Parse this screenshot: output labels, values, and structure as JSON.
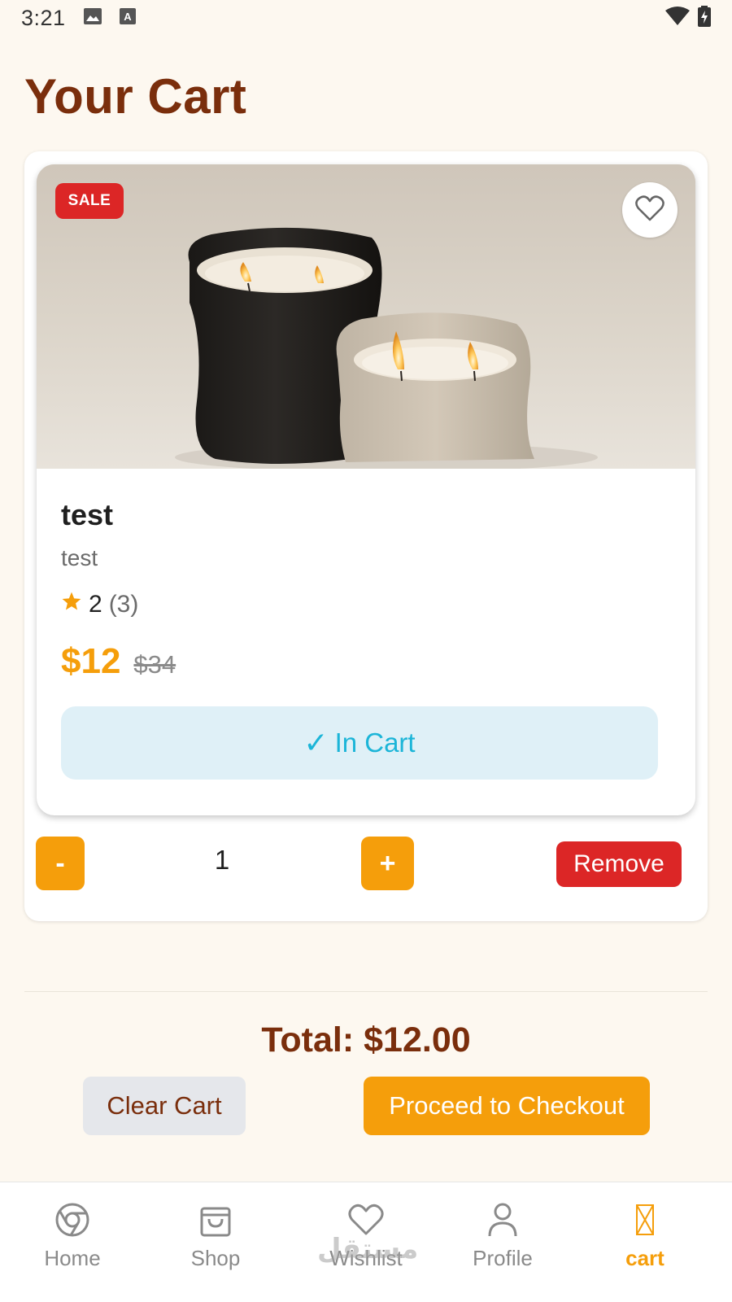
{
  "status_bar": {
    "time": "3:21",
    "icons": [
      "image-icon",
      "font-a-icon",
      "wifi-icon",
      "battery-charging-icon"
    ]
  },
  "page": {
    "title": "Your Cart"
  },
  "colors": {
    "title": "#7a2e0c",
    "accent": "#f59e0b",
    "danger": "#dc2626",
    "in_cart_bg": "#dff0f7",
    "in_cart_text": "#1cb5d8",
    "background": "#fdf8f0"
  },
  "cart_item": {
    "badge": "SALE",
    "name": "test",
    "description": "test",
    "rating": "2",
    "rating_count": "(3)",
    "price": "$12",
    "original_price": "$34",
    "in_cart_check": "✓",
    "in_cart_label": "In Cart",
    "quantity": "1",
    "minus_label": "-",
    "plus_label": "+",
    "remove_label": "Remove"
  },
  "summary": {
    "total": "Total: $12.00",
    "clear_label": "Clear Cart",
    "checkout_label": "Proceed to Checkout"
  },
  "nav": {
    "items": [
      {
        "label": "Home",
        "icon": "chrome-icon"
      },
      {
        "label": "Shop",
        "icon": "shopping-bag-icon"
      },
      {
        "label": "Wishlist",
        "icon": "heart-icon"
      },
      {
        "label": "Profile",
        "icon": "user-icon"
      },
      {
        "label": "cart",
        "icon": "cart-icon",
        "active": true
      }
    ],
    "watermark": "مستقل"
  }
}
